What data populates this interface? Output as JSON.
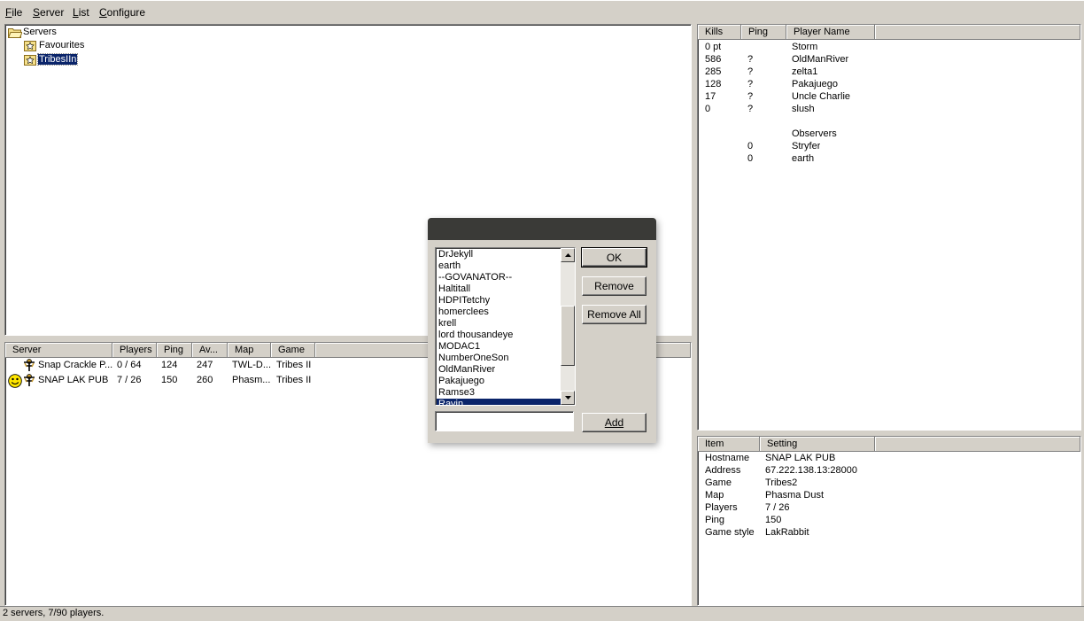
{
  "menu": {
    "file": {
      "ul": "F",
      "rest": "ile"
    },
    "server": {
      "ul": "S",
      "rest": "erver"
    },
    "list": {
      "ul": "L",
      "rest": "ist"
    },
    "configure": {
      "ul": "C",
      "rest": "onfigure"
    }
  },
  "tree": {
    "root": "Servers",
    "children": [
      "Favourites",
      "TribesIIn"
    ],
    "selected": "TribesIIn"
  },
  "server_list": {
    "columns": [
      "Server",
      "Players",
      "Ping",
      "Av...",
      "Map",
      "Game"
    ],
    "rows": [
      {
        "server": "Snap Crackle P...",
        "players": "0 / 64",
        "ping": "124",
        "av": "247",
        "map": "TWL-D...",
        "game": "Tribes II",
        "icons": [
          "tribes-icon"
        ]
      },
      {
        "server": "SNAP LAK PUB",
        "players": "7 / 26",
        "ping": "150",
        "av": "260",
        "map": "Phasm...",
        "game": "Tribes II",
        "icons": [
          "smiley-icon",
          "tribes-icon"
        ]
      }
    ]
  },
  "players": {
    "columns": [
      "Kills",
      "Ping",
      "Player Name"
    ],
    "rows": [
      {
        "kills": "0 pt",
        "ping": "",
        "name": "Storm"
      },
      {
        "kills": "586",
        "ping": "?",
        "name": "OldManRiver"
      },
      {
        "kills": "285",
        "ping": "?",
        "name": "zelta1"
      },
      {
        "kills": "128",
        "ping": "?",
        "name": "Pakajuego"
      },
      {
        "kills": "17",
        "ping": "?",
        "name": "Uncle Charlie"
      },
      {
        "kills": "0",
        "ping": "?",
        "name": "slush"
      },
      {
        "kills": "",
        "ping": "",
        "name": ""
      },
      {
        "kills": "",
        "ping": "",
        "name": "Observers"
      },
      {
        "kills": "",
        "ping": "0",
        "name": "Stryfer"
      },
      {
        "kills": "",
        "ping": "0",
        "name": "earth"
      }
    ]
  },
  "info": {
    "columns": [
      "Item",
      "Setting"
    ],
    "rows": [
      {
        "item": "Hostname",
        "setting": "SNAP LAK PUB"
      },
      {
        "item": "Address",
        "setting": "67.222.138.13:28000"
      },
      {
        "item": "Game",
        "setting": "Tribes2"
      },
      {
        "item": "Map",
        "setting": "Phasma Dust"
      },
      {
        "item": "Players",
        "setting": "7 / 26"
      },
      {
        "item": "Ping",
        "setting": "150"
      },
      {
        "item": "Game style",
        "setting": "LakRabbit"
      }
    ]
  },
  "dialog": {
    "list_items": [
      "DrJekyll",
      "earth",
      "--GOVANATOR--",
      "Haltitall",
      "HDPITetchy",
      "homerclees",
      "krell",
      "lord thousandeye",
      "MODAC1",
      "NumberOneSon",
      "OldManRiver",
      "Pakajuego",
      "Ramse3",
      "Ravin"
    ],
    "selected_item": "Ravin",
    "ok_label": "OK",
    "remove_label": "Remove",
    "remove_all_label": "Remove All",
    "add_label": "Add",
    "input_value": ""
  },
  "status": {
    "text": "2 servers, 7/90 players."
  },
  "colors": {
    "selection": "#0a246a",
    "face": "#d4d0c8",
    "dialog_title": "#3a3a37"
  }
}
